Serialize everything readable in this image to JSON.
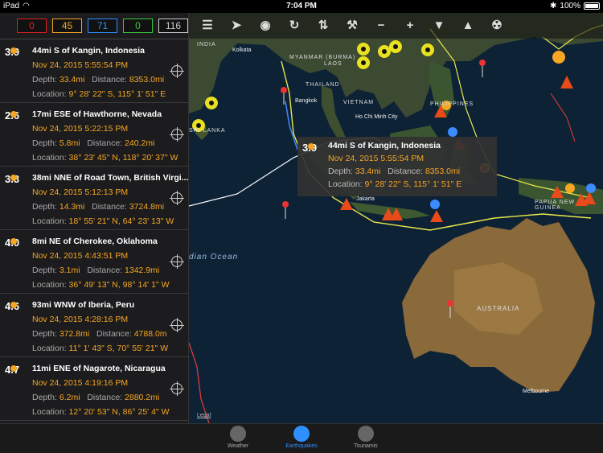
{
  "status_bar": {
    "device": "iPad",
    "time": "7:04 PM",
    "battery": "100%",
    "battery_level": 1.0
  },
  "filters": [
    {
      "count": "0",
      "color": "#e02020"
    },
    {
      "count": "45",
      "color": "#f5a623"
    },
    {
      "count": "71",
      "color": "#2f8fff"
    },
    {
      "count": "0",
      "color": "#3cc83c"
    },
    {
      "count": "116",
      "color": "#cccccc"
    }
  ],
  "quakes": [
    {
      "mag": "3.9",
      "place": "44mi S of Kangin, Indonesia",
      "time": "Nov 24, 2015   5:55:54 PM",
      "depth": "33.4mi",
      "distance": "8353.0mi",
      "location": "9° 28' 22\" S, 115° 1' 51\" E"
    },
    {
      "mag": "2.6",
      "place": "17mi ESE of Hawthorne, Nevada",
      "time": "Nov 24, 2015   5:22:15 PM",
      "depth": "5.8mi",
      "distance": "240.2mi",
      "location": "38° 23' 45\" N, 118° 20' 37\" W"
    },
    {
      "mag": "3.3",
      "place": "38mi NNE of Road Town, British Virgi...",
      "time": "Nov 24, 2015   5:12:13 PM",
      "depth": "14.3mi",
      "distance": "3724.8mi",
      "location": "18° 55' 21\" N, 64° 23' 13\" W"
    },
    {
      "mag": "4.0",
      "place": "8mi NE of Cherokee, Oklahoma",
      "time": "Nov 24, 2015   4:43:51 PM",
      "depth": "3.1mi",
      "distance": "1342.9mi",
      "location": "36° 49' 13\" N, 98° 14' 1\" W"
    },
    {
      "mag": "4.6",
      "place": "93mi WNW of Iberia, Peru",
      "time": "Nov 24, 2015   4:28:16 PM",
      "depth": "372.8mi",
      "distance": "4788.0m",
      "location": "11° 1' 43\" S, 70° 55' 21\" W"
    },
    {
      "mag": "4.7",
      "place": "11mi ENE of Nagarote, Nicaragua",
      "time": "Nov 24, 2015   4:19:16 PM",
      "depth": "6.2mi",
      "distance": "2880.2mi",
      "location": "12° 20' 53\" N, 86° 25' 4\" W"
    }
  ],
  "labels": {
    "depth": "Depth:",
    "distance": "Distance:",
    "location": "Location:"
  },
  "toolbar": [
    {
      "name": "menu-icon",
      "glyph": "☰"
    },
    {
      "name": "locate-icon",
      "glyph": "➤"
    },
    {
      "name": "eye-icon",
      "glyph": "◉"
    },
    {
      "name": "refresh-icon",
      "glyph": "↻"
    },
    {
      "name": "sort-icon",
      "glyph": "⇅"
    },
    {
      "name": "wrench-icon",
      "glyph": "⚒"
    },
    {
      "name": "zoom-out-icon",
      "glyph": "−"
    },
    {
      "name": "zoom-in-icon",
      "glyph": "+"
    },
    {
      "name": "filter-icon",
      "glyph": "▼"
    },
    {
      "name": "triangle-icon",
      "glyph": "▲"
    },
    {
      "name": "radiation-icon",
      "glyph": "☢"
    }
  ],
  "popup": {
    "mag": "3.9",
    "place": "44mi S of Kangin, Indonesia",
    "time": "Nov 24, 2015   5:55:54 PM",
    "depth": "33.4mi",
    "distance": "8353.0mi",
    "location": "9° 28' 22\" S, 115° 1' 51\" E"
  },
  "map_labels": {
    "india": "INDIA",
    "myanmar": "MYANMAR (BURMA)",
    "laos": "LAOS",
    "thailand": "THAILAND",
    "vietnam": "VIETNAM",
    "philippines": "PHILIPPINES",
    "sri_lanka": "SRI LANKA",
    "papua": "PAPUA NEW GUINEA",
    "australia": "AUSTRALIA",
    "kolkata": "Kolkata",
    "bangkok": "Bangkok",
    "hcmc": "Ho Chi Minh City",
    "jakarta": "Jakarta",
    "melbourne": "Melbourne",
    "ocean": "dian Ocean",
    "legal": "Legal"
  },
  "tabs": [
    {
      "label": "Weather",
      "active": false
    },
    {
      "label": "Earthquakes",
      "active": true
    },
    {
      "label": "Tsunamis",
      "active": false
    }
  ]
}
